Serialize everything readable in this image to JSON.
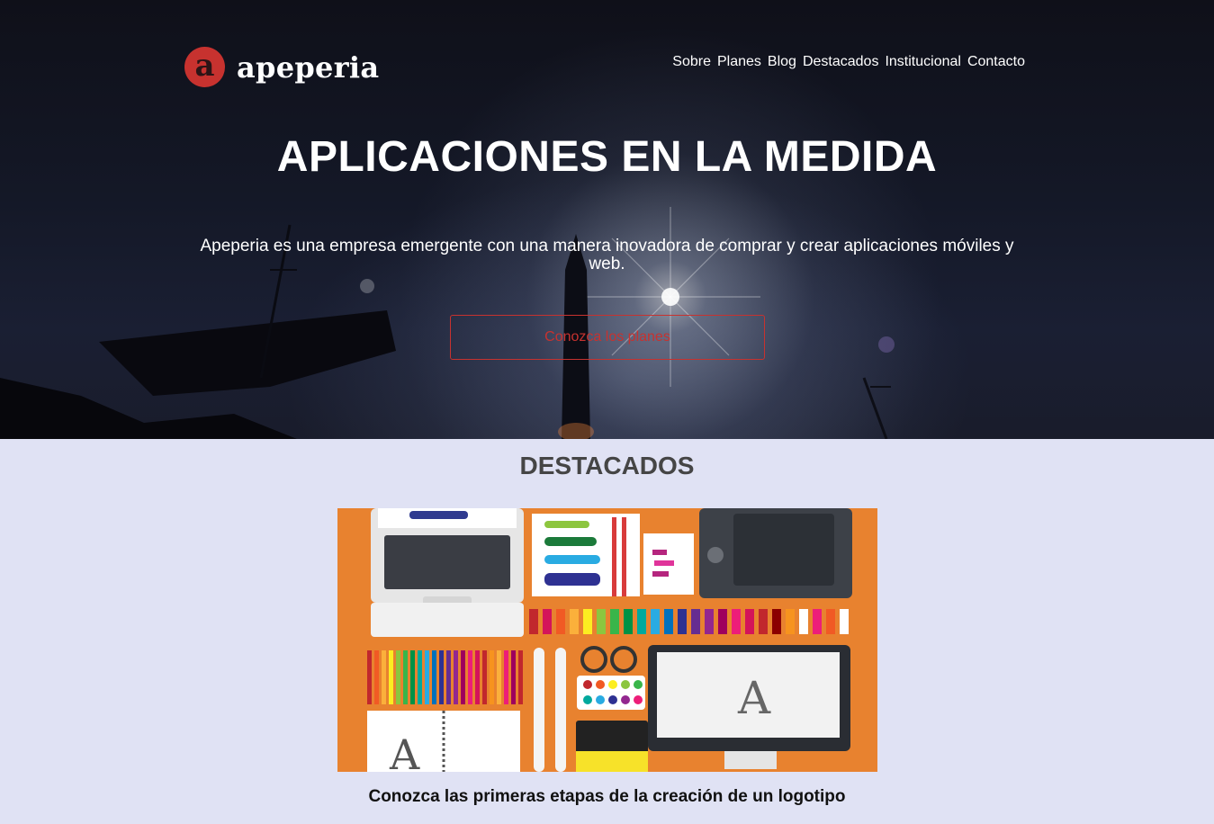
{
  "brand": {
    "logo_letter": "a",
    "name": "apeperia",
    "accent_color": "#c7322f"
  },
  "nav": {
    "items": [
      "Sobre",
      "Planes",
      "Blog",
      "Destacados",
      "Institucional",
      "Contacto"
    ]
  },
  "hero": {
    "title": "APLICACIONES EN LA MEDIDA",
    "description": "Apeperia es una empresa emergente con una manera inovadora de comprar y crear aplicaciones móviles y web.",
    "cta_label": "Conozca los planes"
  },
  "featured": {
    "section_title": "DESTACADOS",
    "caption": "Conozca las primeras etapas de la creación de un logotipo",
    "image_background": "#e8822f"
  }
}
